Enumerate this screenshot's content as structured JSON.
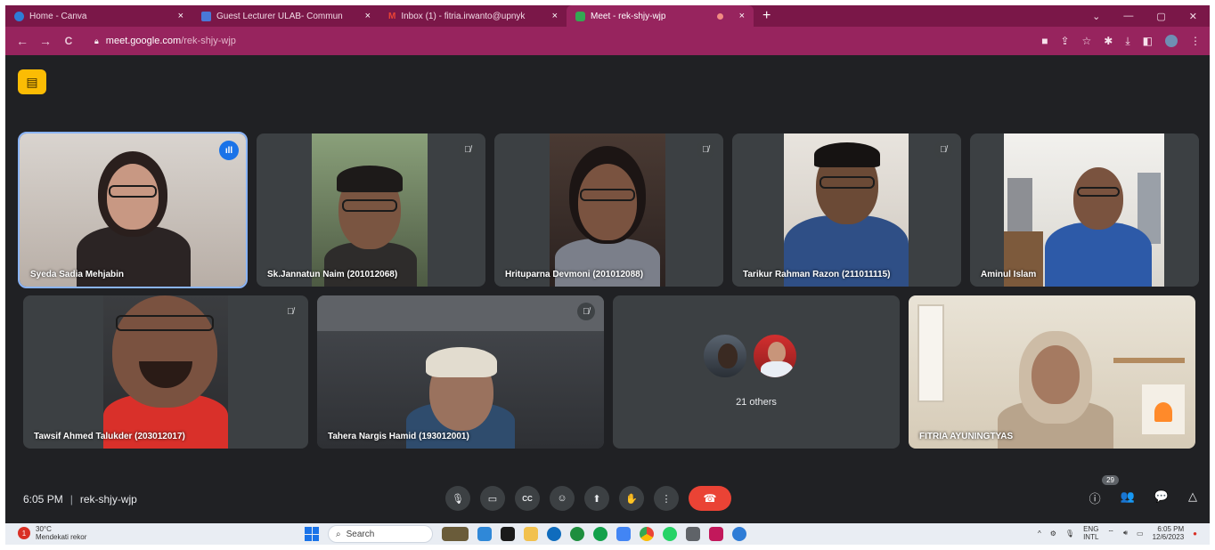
{
  "browser": {
    "tabs": [
      {
        "label": "Home - Canva",
        "icon": "canva-icon",
        "color": "#2e7cd6",
        "close": "×"
      },
      {
        "label": "Guest Lecturer ULAB- Commun",
        "icon": "chat-icon",
        "color": "#4a78d8",
        "close": "×"
      },
      {
        "label": "Inbox (1) - fitria.irwanto@upnyk",
        "icon": "gmail-icon",
        "color": "#ea4335",
        "close": "×"
      },
      {
        "label": "Meet - rek-shjy-wjp",
        "icon": "meet-icon",
        "color": "#34a853",
        "close": "×",
        "active": true
      }
    ],
    "new_tab": "+",
    "window_controls": {
      "chevron": "⌄",
      "minimize": "—",
      "maximize": "▢",
      "close": "✕"
    },
    "nav": {
      "back": "←",
      "forward": "→",
      "reload": "C"
    },
    "url_host": "meet.google.com",
    "url_path": "/rek-shjy-wjp"
  },
  "meeting": {
    "activity_icon": "activities-icon",
    "tiles": [
      {
        "name": "Syeda Sadia Mehjabin",
        "speaking": true,
        "speaking_label": "ıll"
      },
      {
        "name": "Sk.Jannatun Naim (201012068)",
        "muted": true
      },
      {
        "name": "Hrituparna Devmoni (201012088)",
        "muted": true
      },
      {
        "name": "Tarikur Rahman Razon (211011115)",
        "muted": true
      },
      {
        "name": "Aminul Islam",
        "muted": false
      },
      {
        "name": "Tawsif Ahmed Talukder (203012017)",
        "muted": true
      },
      {
        "name": "Tahera Nargis Hamid (193012001)",
        "muted": true
      },
      {
        "name": "21 others",
        "muted": false
      },
      {
        "name": "FITRIA AYUNINGTYAS",
        "muted": false
      }
    ],
    "mute_glyph": "🎙̸"
  },
  "bottom_bar": {
    "time": "6:05 PM",
    "separator": "|",
    "meeting_code": "rek-shjy-wjp",
    "participant_count": "29",
    "controls": [
      {
        "name": "microphone-button",
        "glyph": "🎙"
      },
      {
        "name": "camera-button",
        "glyph": "▭"
      },
      {
        "name": "captions-button",
        "glyph": "CC"
      },
      {
        "name": "reactions-button",
        "glyph": "☺"
      },
      {
        "name": "present-button",
        "glyph": "⬆"
      },
      {
        "name": "raise-hand-button",
        "glyph": "✋"
      },
      {
        "name": "more-options-button",
        "glyph": "⋮"
      }
    ],
    "end_call_glyph": "☎",
    "right_controls": [
      {
        "name": "info-button",
        "glyph": "ⓘ"
      },
      {
        "name": "people-button",
        "glyph": "👥"
      },
      {
        "name": "chat-button",
        "glyph": "💬"
      },
      {
        "name": "activities-button",
        "glyph": "△"
      }
    ]
  },
  "taskbar": {
    "temperature": "30°C",
    "weather_text": "Mendekati rekor",
    "weather_badge": "1",
    "search_label": "Search",
    "search_icon": "search-icon",
    "lang_top": "ENG",
    "lang_bottom": "INTL",
    "tray_time": "6:05 PM",
    "tray_date": "12/6/2023",
    "app_colors": [
      "#6a5c3a",
      "#2f88d8",
      "#1a1a1a",
      "#f2c14e",
      "#0f6cbd",
      "#1e8e3e",
      "#12a14b",
      "#4285f4",
      "#d93025",
      "#25d366",
      "#5f6368",
      "#c2185b",
      "#2e7cd6"
    ]
  }
}
